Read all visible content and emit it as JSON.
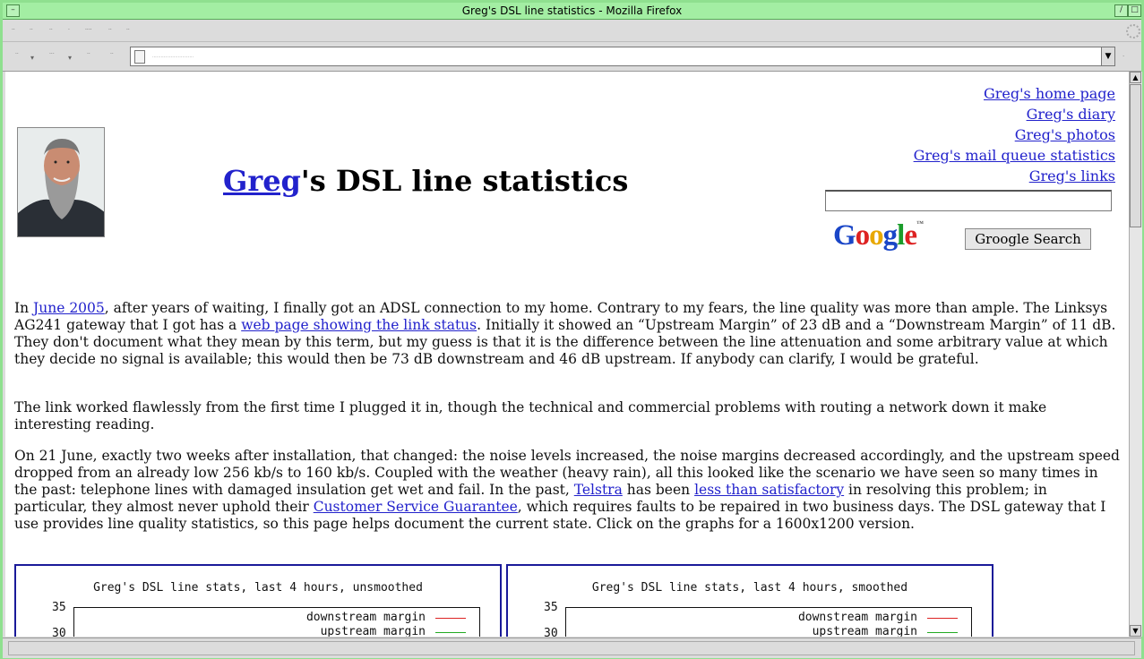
{
  "window": {
    "title": "Greg's DSL line statistics - Mozilla Firefox"
  },
  "page": {
    "heading_link": "Greg",
    "heading_rest": "'s DSL line statistics",
    "links": [
      "Greg's home page",
      "Greg's diary",
      "Greg's photos",
      "Greg's mail queue statistics",
      "Greg's links"
    ],
    "search_button": "Groogle Search",
    "google_logo": "Google",
    "p1": {
      "a": "In ",
      "link1": "June 2005",
      "b": ", after years of waiting, I finally got an ADSL connection to my home. Contrary to my fears, the line quality was more than ample. The Linksys AG241 gateway that I got has a ",
      "link2": "web page showing the link status",
      "c": ". Initially it showed an “Upstream Margin” of 23 dB and a “Downstream Margin” of 11 dB. They don't document what they mean by this term, but my guess is that it is the difference between the line attenuation and some arbitrary value at which they decide no signal is available; this would then be 73 dB downstream and 46 dB upstream. If anybody can clarify, I would be grateful."
    },
    "p2": "The link worked flawlessly from the first time I plugged it in, though the technical and commercial problems with routing a network down it make interesting reading.",
    "p3": {
      "a": "On 21 June, exactly two weeks after installation, that changed: the noise levels increased, the noise margins decreased accordingly, and the upstream speed dropped from an already low 256 kb/s to 160 kb/s. Coupled with the weather (heavy rain), all this looked like the scenario we have seen so many times in the past: telephone lines with damaged insulation get wet and fail. In the past, ",
      "link1": "Telstra",
      "b": " has been ",
      "link2": "less than satisfactory",
      "c": " in resolving this problem; in particular, they almost never uphold their ",
      "link3": "Customer Service Guarantee",
      "d": ", which requires faults to be repaired in two business days. The DSL gateway that I use provides line quality statistics, so this page helps document the current state. Click on the graphs for a 1600x1200 version."
    },
    "graphs": [
      {
        "title": "Greg's DSL line stats, last 4 hours, unsmoothed",
        "y_ticks": [
          "35",
          "30"
        ],
        "legend": [
          "downstream margin",
          "upstream margin"
        ]
      },
      {
        "title": "Greg's DSL line stats, last 4 hours, smoothed",
        "y_ticks": [
          "35",
          "30"
        ],
        "legend": [
          "downstream margin",
          "upstream margin"
        ]
      }
    ],
    "colors": {
      "link": "#2222cc",
      "downstream": "#dd2222",
      "upstream": "#22aa22",
      "frame": "#1a1a99"
    }
  }
}
